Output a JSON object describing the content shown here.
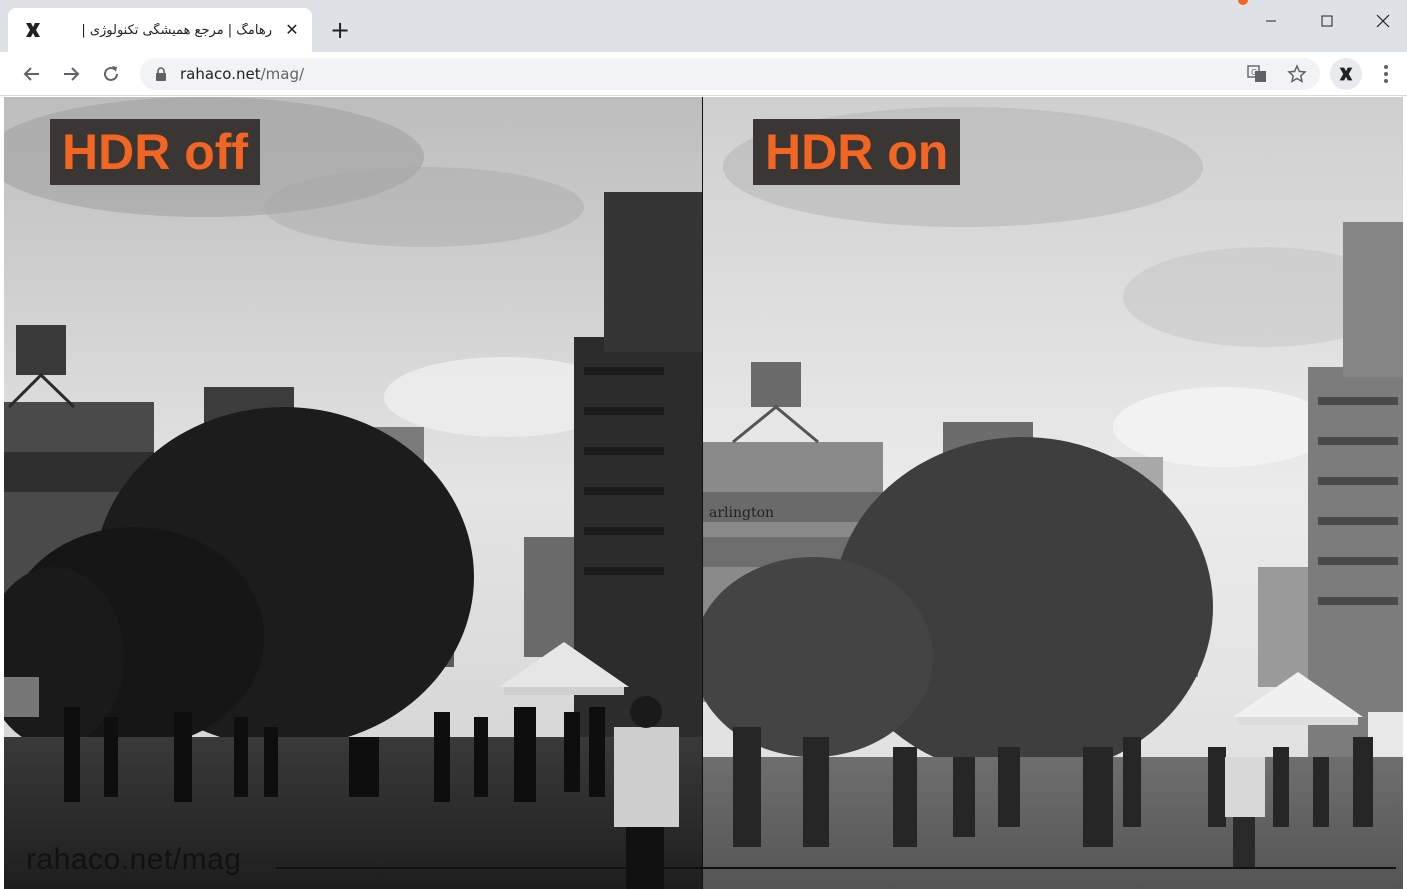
{
  "browser": {
    "tab": {
      "title": "رهامگ | مرجع همیشگی تکنولوژی |",
      "close_glyph": "✕",
      "favicon": "rahaco-logo-icon"
    },
    "new_tab_glyph": "+",
    "url_host": "rahaco.net",
    "url_path": "/mag/",
    "icons": [
      "back-arrow-icon",
      "forward-arrow-icon",
      "reload-icon",
      "lock-icon",
      "translate-icon",
      "star-icon",
      "extension-icon",
      "kebab-menu-icon"
    ]
  },
  "content": {
    "left_label": "HDR off",
    "right_label": "HDR on",
    "watermark": "rahaco.net/mag"
  },
  "colors": {
    "accent": "#f26522",
    "label_bg": "#3a3634",
    "chrome_bg": "#dee1e6",
    "omnibox_bg": "#f1f3f4"
  }
}
